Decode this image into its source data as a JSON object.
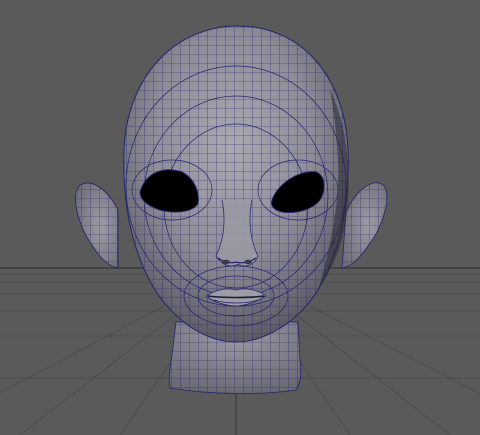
{
  "viewport": {
    "mode": "perspective",
    "display": "smooth-shaded-wireframe",
    "colors": {
      "background": "#5a5a5a",
      "grid": "#4a4a4a",
      "horizon": "#3c3c3c",
      "mesh_fill": "#8e8e98",
      "mesh_wire": "#23236e",
      "eye_sockets": "#000000"
    }
  },
  "scene": {
    "object": "head-mesh",
    "parts": [
      "neck",
      "left-ear",
      "right-ear",
      "cranium",
      "face",
      "eye-sockets",
      "nose",
      "mouth"
    ]
  }
}
